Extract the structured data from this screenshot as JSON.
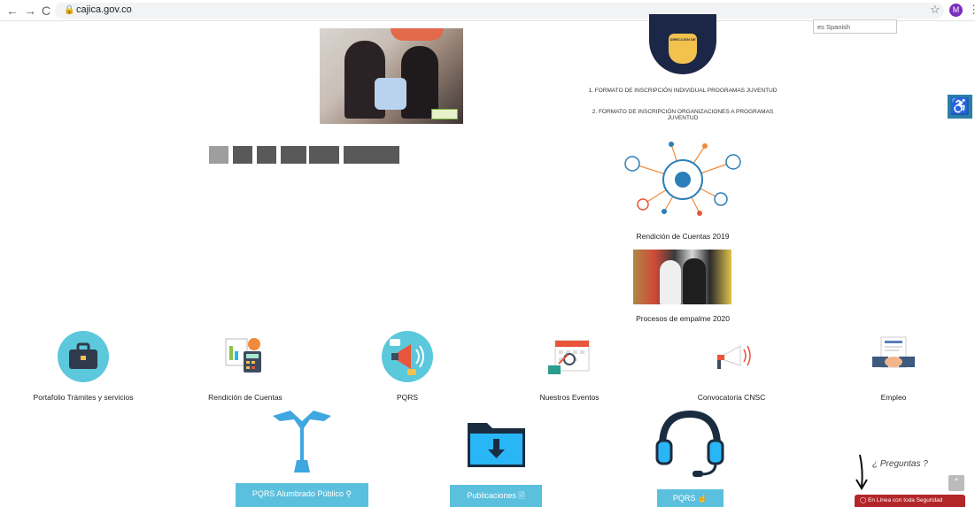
{
  "browser": {
    "back_icon": "←",
    "forward_icon": "→",
    "reload_icon": "C",
    "url": "cajica.gov.co",
    "avatar_initial": "M",
    "star_icon": "☆",
    "menu_icon": "⋮"
  },
  "language": {
    "label": "es Spanish"
  },
  "accessibility": {
    "icon": "wheelchair-icon"
  },
  "right_column": {
    "logo_text": "DIRECCIÓN DE",
    "link_1": "1. FORMATO DE INSCRIPCIÓN INDIVIDUAL PROGRAMAS JUVENTUD",
    "link_2": "2. FORMATO DE INSCRIPCIÓN ORGANIZACIONES A PROGRAMAS JUVENTUD",
    "caption_cuentas": "Rendición de Cuentas 2019",
    "caption_empalme": "Procesos de empalme 2020"
  },
  "icon_row": [
    {
      "label": "Portafolio Trámites y servicios",
      "icon": "briefcase-icon"
    },
    {
      "label": "Rendición de Cuentas",
      "icon": "calculator-icon"
    },
    {
      "label": "PQRS",
      "icon": "megaphone-icon"
    },
    {
      "label": "Nuestros Eventos",
      "icon": "calendar-icon"
    },
    {
      "label": "Convocatoria CNSC",
      "icon": "announcement-icon"
    },
    {
      "label": "Empleo",
      "icon": "handshake-icon"
    }
  ],
  "bottom": {
    "alumbrado": "PQRS Alumbrado Público",
    "publicaciones": "Publicaciones",
    "pqrs": "PQRS",
    "preguntas": "¿ Preguntas ?",
    "chat": "En Línea con toda Seguridad",
    "scroll_top": "⌃"
  },
  "colors": {
    "accent": "#5bc0de",
    "navy": "#1c2646",
    "chat": "#b3262a",
    "access": "#2a7fa8"
  }
}
